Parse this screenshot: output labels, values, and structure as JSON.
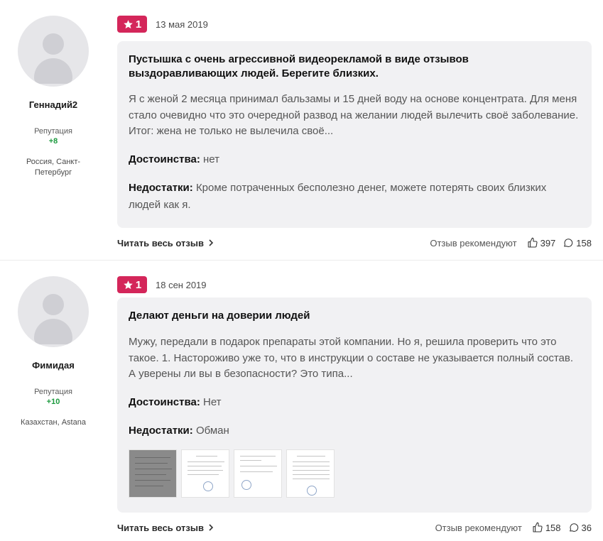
{
  "reviews": [
    {
      "author": {
        "name": "Геннадий2",
        "reputation_label": "Репутация",
        "reputation": "+8",
        "location": "Россия, Санкт-Петербург"
      },
      "rating": "1",
      "date": "13 мая 2019",
      "title": "Пустышка с очень агрессивной видеорекламой в виде отзывов выздоравливающих людей. Берегите близких.",
      "text": "Я с женой 2 месяца принимал бальзамы и 15 дней воду на основе концентрата. Для меня стало очевидно что это очередной развод на желании людей вылечить своё заболевание. Итог: жена не только не вылечила своё...",
      "pros_label": "Достоинства:",
      "pros": "нет",
      "cons_label": "Недостатки:",
      "cons": "Кроме потраченных бесполезно денег, можете потерять своих близких людей как я.",
      "read_more": "Читать весь отзыв",
      "recommend": "Отзыв рекомендуют",
      "likes": "397",
      "comments": "158"
    },
    {
      "author": {
        "name": "Фимидая",
        "reputation_label": "Репутация",
        "reputation": "+10",
        "location": "Казахстан, Astana"
      },
      "rating": "1",
      "date": "18 сен 2019",
      "title": "Делают деньги на доверии людей",
      "text": "Мужу, передали в подарок препараты этой компании. Но я, решила проверить что это такое. 1. Настороживо уже то, что в инструкции о составе не указывается полный состав. А уверены ли вы в безопасности? Это типа...",
      "pros_label": "Достоинства:",
      "pros": "Нет",
      "cons_label": "Недостатки:",
      "cons": "Обман",
      "read_more": "Читать весь отзыв",
      "recommend": "Отзыв рекомендуют",
      "likes": "158",
      "comments": "36"
    }
  ],
  "colors": {
    "badge": "#d4265a",
    "reputation": "#1c9a3e",
    "card": "#f1f1f3"
  }
}
